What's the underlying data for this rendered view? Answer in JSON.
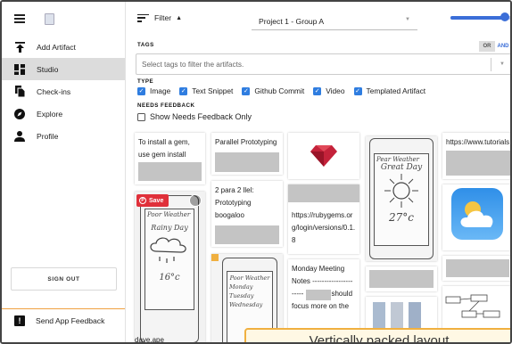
{
  "sidebar": {
    "items": [
      {
        "label": "Add Artifact",
        "icon": "upload-icon",
        "active": false
      },
      {
        "label": "Studio",
        "icon": "dashboard-icon",
        "active": true
      },
      {
        "label": "Check-ins",
        "icon": "documents-icon",
        "active": false
      },
      {
        "label": "Explore",
        "icon": "compass-icon",
        "active": false
      },
      {
        "label": "Profile",
        "icon": "person-icon",
        "active": false
      }
    ],
    "sign_out": "SIGN OUT",
    "feedback": "Send App Feedback"
  },
  "toolbar": {
    "filter_label": "Filter",
    "project": "Project 1 - Group A",
    "zoom_level": 0.87
  },
  "filters": {
    "tags_label": "TAGS",
    "or_label": "OR",
    "and_label": "AND",
    "tags_placeholder": "Select tags to filter the artifacts.",
    "type_label": "TYPE",
    "types": [
      {
        "label": "Image",
        "checked": true
      },
      {
        "label": "Text Snippet",
        "checked": true
      },
      {
        "label": "Github Commit",
        "checked": true
      },
      {
        "label": "Video",
        "checked": true
      },
      {
        "label": "Templated Artifact",
        "checked": true
      }
    ],
    "needs_feedback_label": "NEEDS FEEDBACK",
    "show_needs_feedback": "Show Needs Feedback Only"
  },
  "cards": {
    "gem_text": "To install a gem, use gem install [gem] .",
    "parallel_text": "Parallel Prototyping",
    "para_text": "2 para 2 llel: Prototyping boogaloo",
    "rubygems_text": "https://rubygems.org/login/versions/0.1.8",
    "tutorials_text": "https://www.tutorials",
    "monday_text": "Monday Meeting Notes ----------------- ----- inks we should focus more on the",
    "save_label": "Save",
    "partial_text": "dave.ape",
    "sketch1_lines": [
      "Pear Weather",
      "Great Day",
      "27°c"
    ],
    "sketch2_lines": [
      "Poor Weather",
      "Rainy Day",
      "16°c"
    ],
    "sketch3_lines": [
      "Poor Weather",
      "Monday",
      "Tuesday",
      "Wednesday"
    ]
  },
  "banner": "Vertically packed layout",
  "colors": {
    "accent": "#2f7de0",
    "save": "#e0303a",
    "banner_border": "#f0b040"
  }
}
